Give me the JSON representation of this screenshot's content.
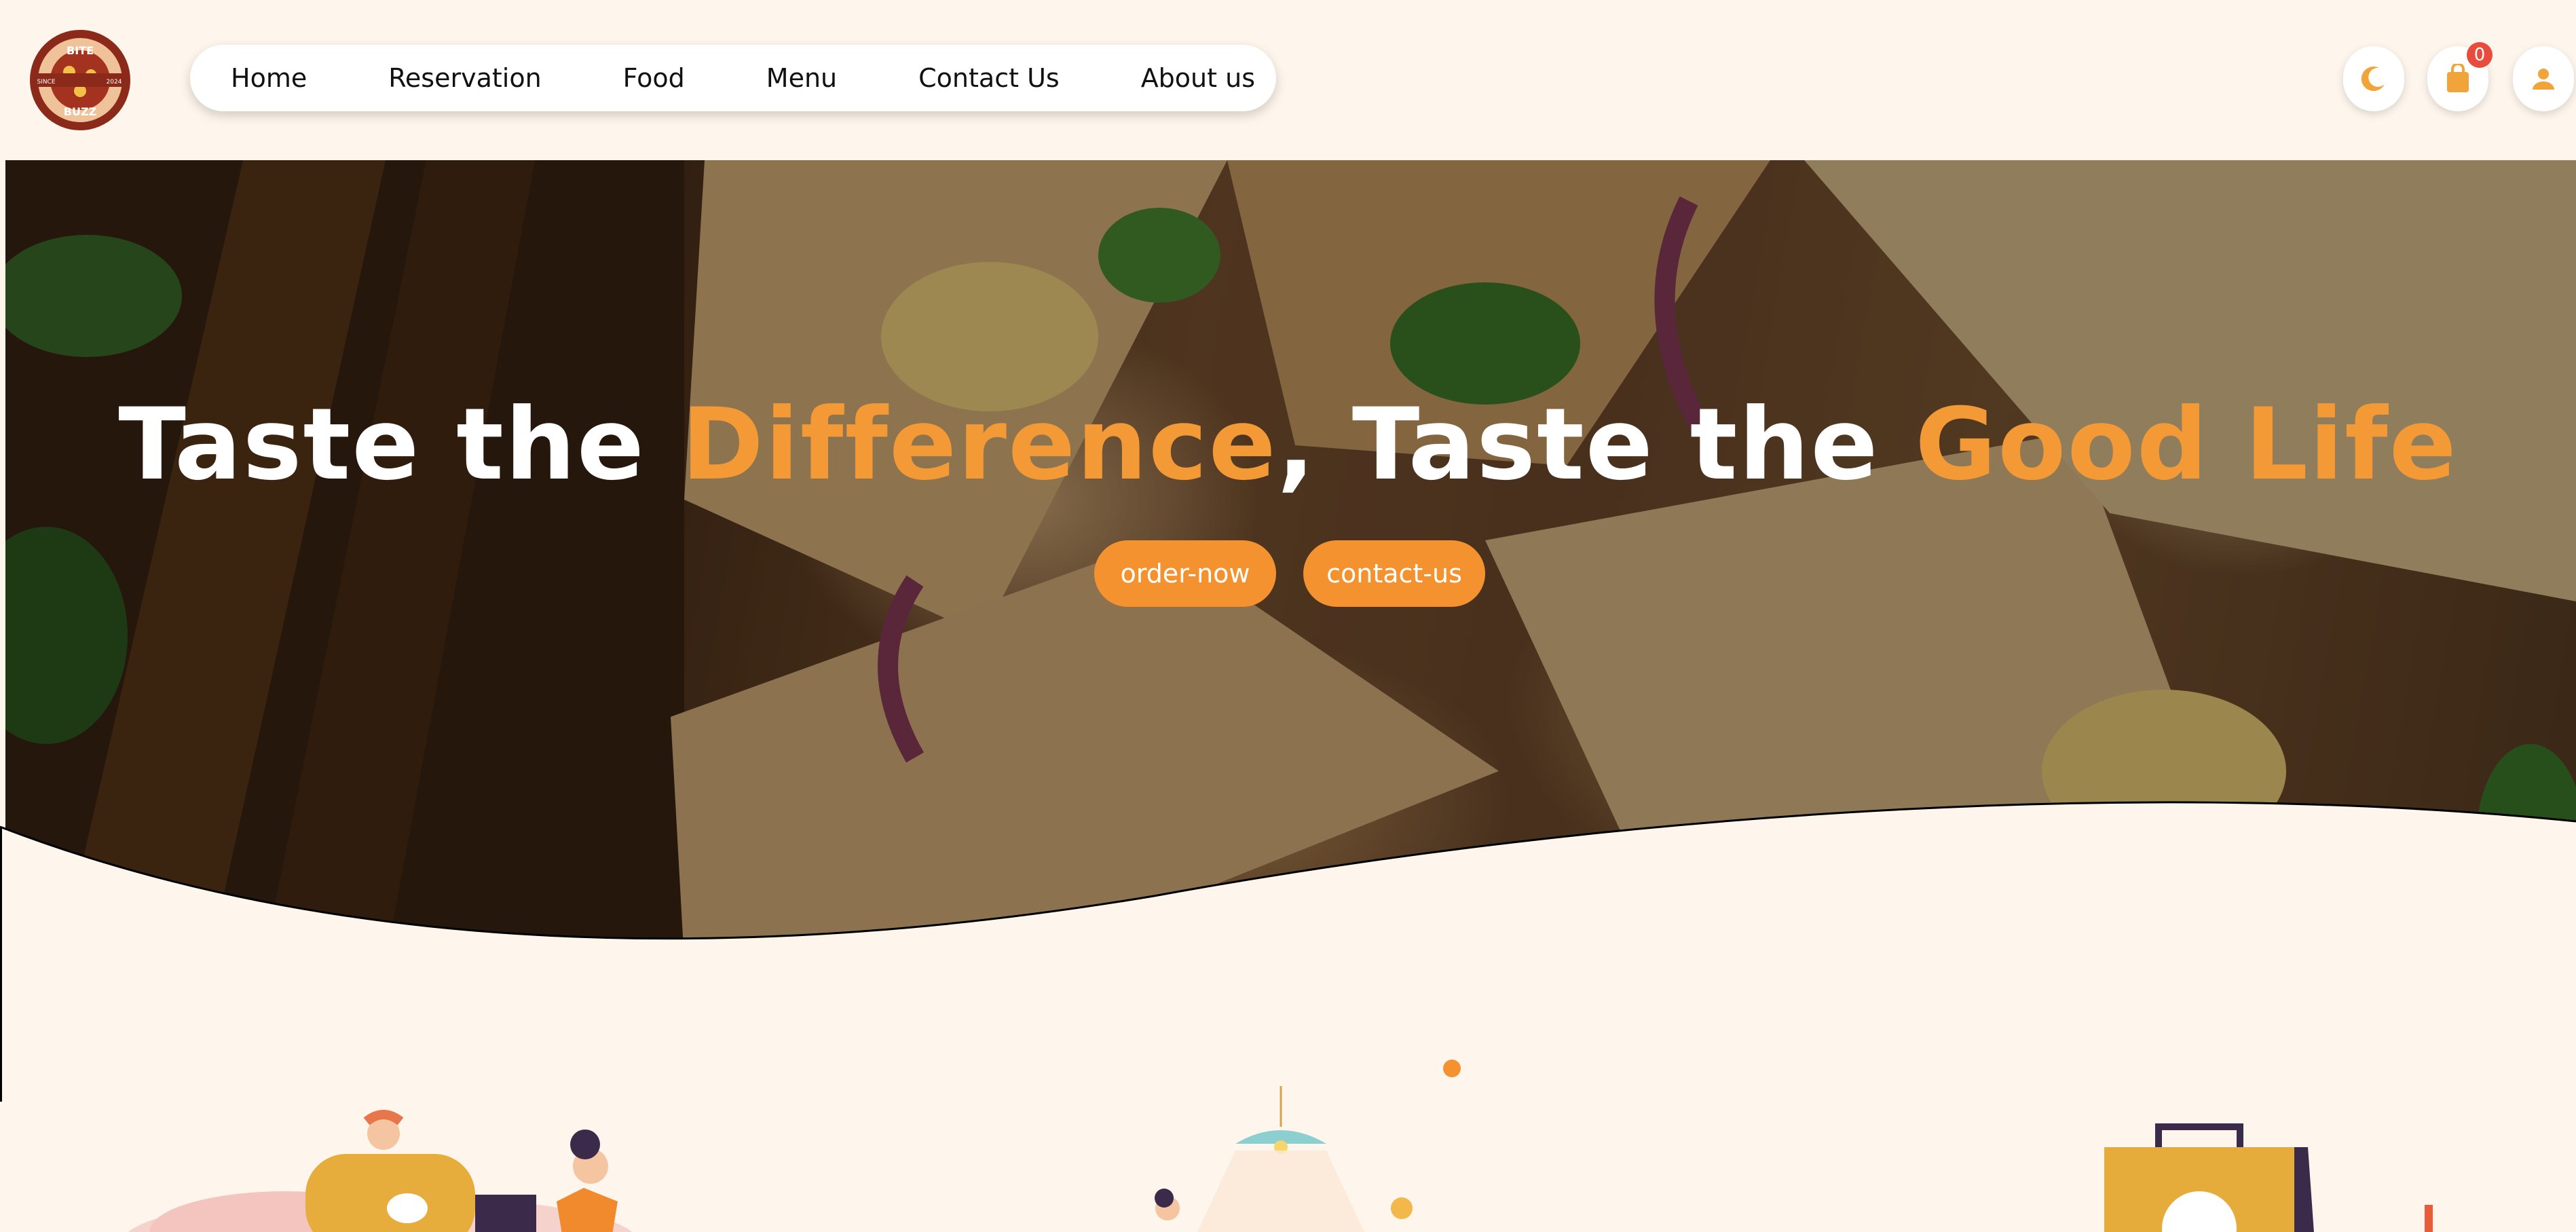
{
  "logo": {
    "text_top": "BITE",
    "text_bottom": "BUZZ",
    "year_left": "SINCE",
    "year_right": "2024"
  },
  "nav": {
    "items": [
      "Home",
      "Reservation",
      "Food",
      "Menu",
      "Contact Us",
      "About us"
    ]
  },
  "header_icons": {
    "cart_count": "0"
  },
  "hero": {
    "title_part1": "Taste the ",
    "title_accent1": "Difference",
    "title_part2": ", Taste the ",
    "title_accent2": "Good Life",
    "order_button": "order-now",
    "contact_button": "contact-us"
  },
  "colors": {
    "accent": "#f3922f",
    "background": "#fef6ec",
    "badge": "#e94b3c"
  }
}
